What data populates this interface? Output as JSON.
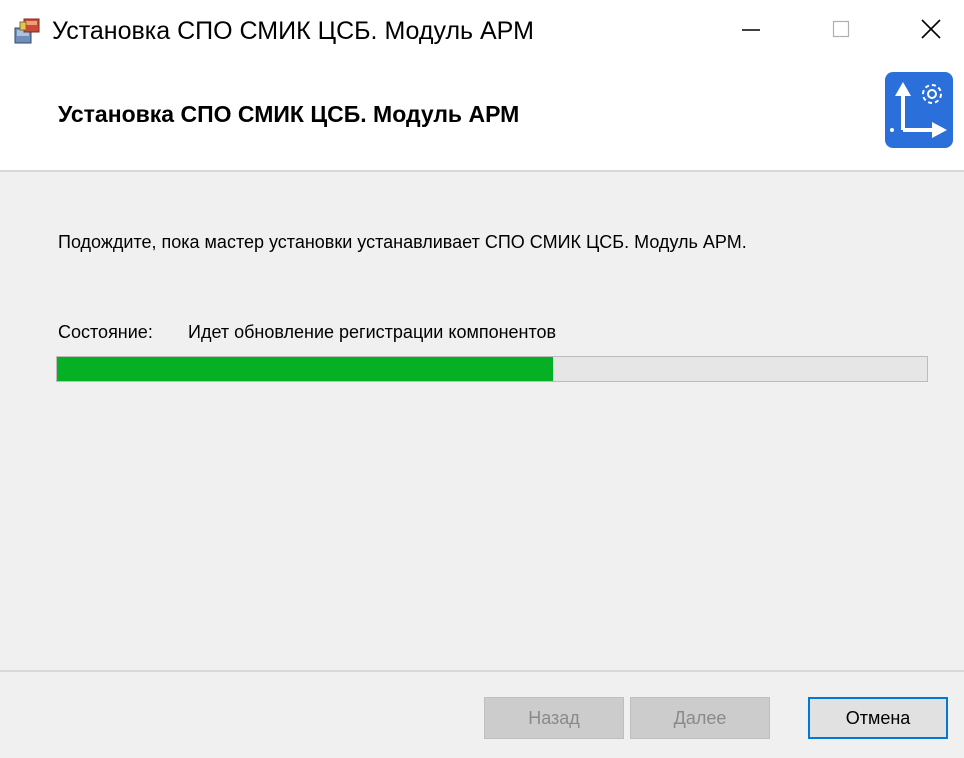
{
  "window": {
    "title": "Установка СПО СМИК ЦСБ. Модуль АРМ",
    "app_icon": "installer-package-icon",
    "controls": {
      "minimize_icon": "minimize-icon",
      "maximize_icon": "maximize-icon",
      "close_icon": "close-icon"
    }
  },
  "header": {
    "title": "Установка СПО СМИК ЦСБ. Модуль АРМ",
    "logo_icon": "axes-gear-logo-icon",
    "logo_color": "#2b6fdb"
  },
  "content": {
    "description": "Подождите, пока мастер установки устанавливает СПО СМИК ЦСБ. Модуль АРМ.",
    "status_label": "Состояние:",
    "status_value": "Идет обновление регистрации компонентов",
    "progress": {
      "percent": 57,
      "fill_color": "#06b025"
    }
  },
  "footer": {
    "back_label": "Назад",
    "next_label": "Далее",
    "cancel_label": "Отмена",
    "back_enabled": false,
    "next_enabled": false
  }
}
